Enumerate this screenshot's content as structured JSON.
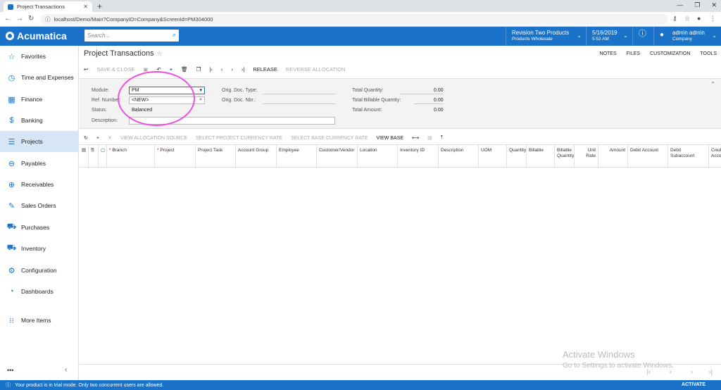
{
  "browser": {
    "tab_title": "Project Transactions",
    "url": "localhost/Demo/Main?CompanyID=Company&ScreenId=PM304000"
  },
  "app": {
    "brand": "Acumatica",
    "search_placeholder": "Search...",
    "branch_name": "Revision Two Products",
    "branch_sub": "Products Wholesale",
    "date": "5/16/2019",
    "time": "5:52 AM",
    "user_name": "admin admin",
    "user_company": "Company"
  },
  "sidebar": {
    "items": [
      {
        "label": "Favorites",
        "icon": "star-icon"
      },
      {
        "label": "Time and Expenses",
        "icon": "clock-icon"
      },
      {
        "label": "Finance",
        "icon": "calculator-icon"
      },
      {
        "label": "Banking",
        "icon": "dollar-icon"
      },
      {
        "label": "Projects",
        "icon": "projects-icon"
      },
      {
        "label": "Payables",
        "icon": "minus-circle-icon"
      },
      {
        "label": "Receivables",
        "icon": "plus-circle-icon"
      },
      {
        "label": "Sales Orders",
        "icon": "edit-icon"
      },
      {
        "label": "Purchases",
        "icon": "cart-icon"
      },
      {
        "label": "Inventory",
        "icon": "truck-icon"
      },
      {
        "label": "Configuration",
        "icon": "gear-icon"
      },
      {
        "label": "Dashboards",
        "icon": "gauge-icon"
      },
      {
        "label": "More Items",
        "icon": "grid-icon"
      }
    ]
  },
  "screen": {
    "title": "Project Transactions",
    "links": [
      "NOTES",
      "FILES",
      "CUSTOMIZATION",
      "TOOLS"
    ],
    "toolbar": {
      "save_close": "SAVE & CLOSE",
      "release": "RELEASE",
      "reverse": "REVERSE ALLOCATION"
    },
    "form": {
      "module_label": "Module:",
      "module_value": "PM",
      "ref_label": "Ref. Number:",
      "ref_value": "<NEW>",
      "status_label": "Status:",
      "status_value": "Balanced",
      "desc_label": "Description:",
      "orig_type_label": "Orig. Doc. Type:",
      "orig_nbr_label": "Orig. Doc. Nbr.:",
      "total_qty_label": "Total Quantity:",
      "total_qty": "0.00",
      "total_bill_label": "Total Billable Quantity:",
      "total_bill": "0.00",
      "total_amt_label": "Total Amount:",
      "total_amt": "0.00"
    },
    "grid_toolbar": {
      "view_alloc": "VIEW ALLOCATION SOURCE",
      "select_proj": "SELECT PROJECT CURRENCY RATE",
      "select_base": "SELECT BASE CURRENCY RATE",
      "view_base": "VIEW BASE"
    },
    "columns": [
      "Branch",
      "Project",
      "Project Task",
      "Account Group",
      "Employee",
      "Customer/Vendor",
      "Location",
      "Inventory ID",
      "Description",
      "UOM",
      "Quantity",
      "Billable",
      "Billable Quantity",
      "Unit Rate",
      "Amount",
      "Debit Account",
      "Debit Subaccount",
      "Credit Account"
    ]
  },
  "watermark": {
    "title": "Activate Windows",
    "sub": "Go to Settings to activate Windows."
  },
  "statusbar": {
    "message": "Your product is in trial mode. Only two concurrent users are allowed.",
    "activate": "ACTIVATE"
  }
}
